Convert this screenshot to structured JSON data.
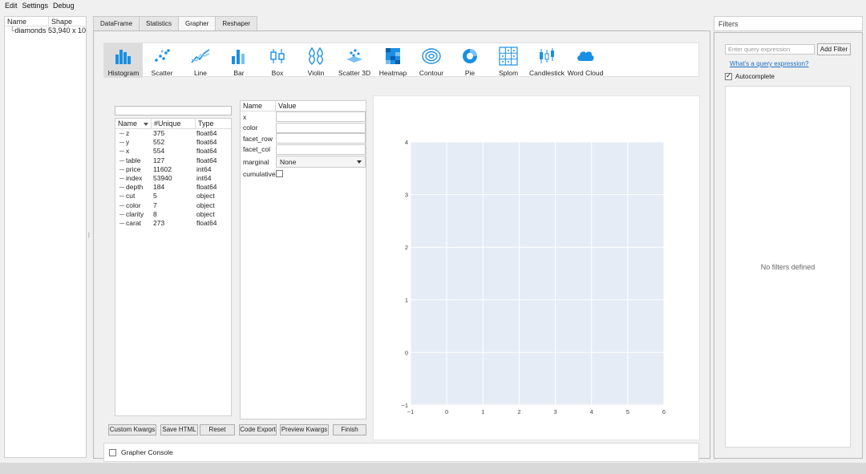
{
  "menu": [
    "Edit",
    "Settings",
    "Debug"
  ],
  "left_panel": {
    "headers": [
      "Name",
      "Shape"
    ],
    "rows": [
      {
        "name": "diamonds",
        "shape": "53,940 x 10"
      }
    ],
    "tree_glyph": "└"
  },
  "tabs": [
    "DataFrame",
    "Statistics",
    "Grapher",
    "Reshaper"
  ],
  "active_tab": "Grapher",
  "chart_types": [
    {
      "label": "Histogram",
      "icon": "histogram-icon",
      "active": true
    },
    {
      "label": "Scatter",
      "icon": "scatter-icon"
    },
    {
      "label": "Line",
      "icon": "line-icon"
    },
    {
      "label": "Bar",
      "icon": "bar-icon"
    },
    {
      "label": "Box",
      "icon": "box-icon"
    },
    {
      "label": "Violin",
      "icon": "violin-icon"
    },
    {
      "label": "Scatter 3D",
      "icon": "scatter-3d-icon"
    },
    {
      "label": "Heatmap",
      "icon": "heatmap-icon"
    },
    {
      "label": "Contour",
      "icon": "contour-icon"
    },
    {
      "label": "Pie",
      "icon": "pie-icon"
    },
    {
      "label": "Splom",
      "icon": "splom-icon"
    },
    {
      "label": "Candlestick",
      "icon": "candlestick-icon"
    },
    {
      "label": "Word Cloud",
      "icon": "word-cloud-icon"
    }
  ],
  "columns_table": {
    "headers": [
      "Name",
      "#Unique",
      "Type"
    ],
    "rows": [
      {
        "name": "z",
        "unique": "375",
        "type": "float64"
      },
      {
        "name": "y",
        "unique": "552",
        "type": "float64"
      },
      {
        "name": "x",
        "unique": "554",
        "type": "float64"
      },
      {
        "name": "table",
        "unique": "127",
        "type": "float64"
      },
      {
        "name": "price",
        "unique": "11602",
        "type": "int64"
      },
      {
        "name": "index",
        "unique": "53940",
        "type": "int64"
      },
      {
        "name": "depth",
        "unique": "184",
        "type": "float64"
      },
      {
        "name": "cut",
        "unique": "5",
        "type": "object"
      },
      {
        "name": "color",
        "unique": "7",
        "type": "object"
      },
      {
        "name": "clarity",
        "unique": "8",
        "type": "object"
      },
      {
        "name": "carat",
        "unique": "273",
        "type": "float64"
      }
    ]
  },
  "properties": {
    "headers": [
      "Name",
      "Value"
    ],
    "fields": [
      "x",
      "color",
      "facet_row",
      "facet_col"
    ],
    "marginal_label": "marginal",
    "marginal_value": "None",
    "cumulative_label": "cumulative"
  },
  "plot": {
    "x_ticks": [
      "−1",
      "0",
      "1",
      "2",
      "3",
      "4",
      "5",
      "6"
    ],
    "y_ticks": [
      "−1",
      "0",
      "1",
      "2",
      "3",
      "4"
    ],
    "bg": "#e5ecf6"
  },
  "buttons": [
    "Custom Kwargs",
    "Save HTML",
    "Reset",
    "Code Export",
    "Preview Kwargs",
    "Finish"
  ],
  "console_label": "Grapher Console",
  "filters": {
    "title": "Filters",
    "query_placeholder": "Enter query expression",
    "add_label": "Add Filter",
    "help_link": "What's a query expression?",
    "autocomplete_label": "Autocomplete",
    "empty_text": "No filters defined"
  },
  "colors": {
    "accent": "#1a8fe3",
    "accent_dark": "#1a6fc4"
  }
}
